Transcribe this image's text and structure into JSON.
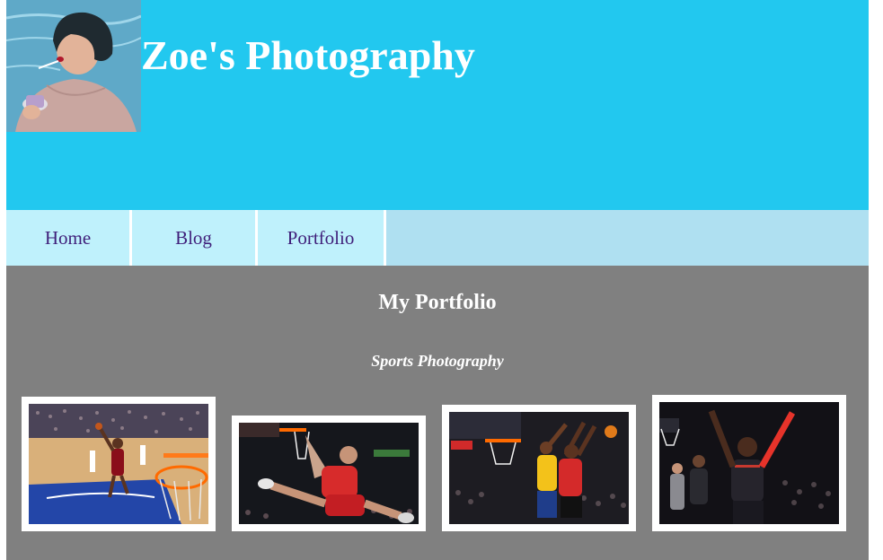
{
  "site": {
    "title": "Zoe's Photography"
  },
  "nav": {
    "items": [
      {
        "label": "Home"
      },
      {
        "label": "Blog"
      },
      {
        "label": "Portfolio"
      }
    ]
  },
  "portfolio": {
    "heading": "My Portfolio",
    "subtitle": "Sports Photography",
    "photos": [
      {
        "subject": "basketball-dunk-miami"
      },
      {
        "subject": "basketball-dunk-clippers"
      },
      {
        "subject": "basketball-block-raptors"
      },
      {
        "subject": "basketball-celebration"
      }
    ]
  },
  "colors": {
    "header": "#22c8ef",
    "nav_bar": "#afe0f1",
    "nav_item": "#bff1fc",
    "main": "#808080",
    "link": "#3f1f7a"
  }
}
